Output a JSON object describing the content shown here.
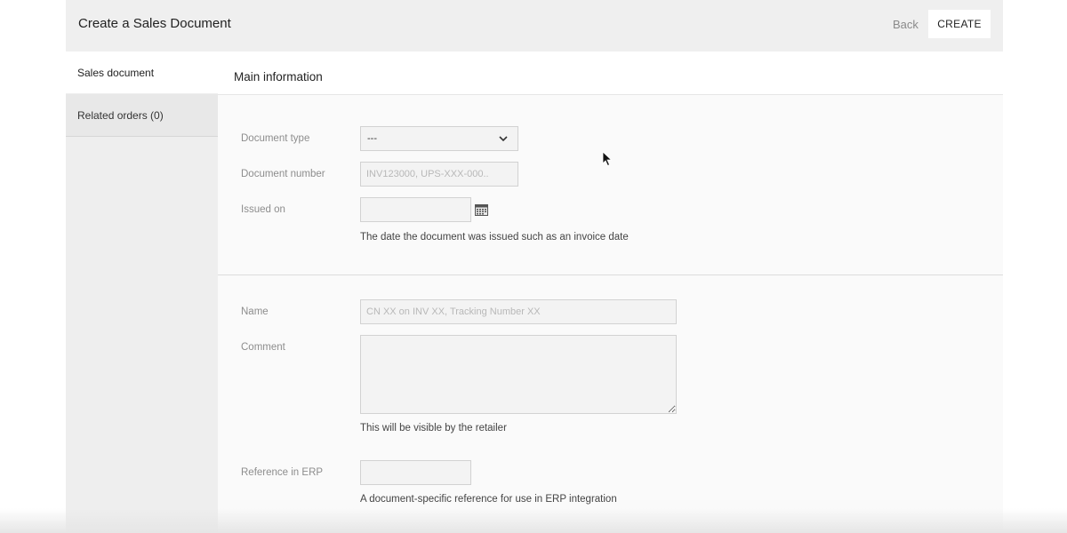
{
  "header": {
    "title": "Create a Sales Document",
    "back_label": "Back",
    "create_label": "CREATE"
  },
  "sidebar": {
    "items": [
      {
        "label": "Sales document",
        "active": true
      },
      {
        "label": "Related orders (0)",
        "active": false
      }
    ]
  },
  "main": {
    "section_title": "Main information",
    "document_type": {
      "label": "Document type",
      "value": "---"
    },
    "document_number": {
      "label": "Document number",
      "value": "",
      "placeholder": "INV123000, UPS-XXX-000.."
    },
    "issued_on": {
      "label": "Issued on",
      "value": "",
      "help": "The date the document was issued such as an invoice date",
      "icon": "calendar-icon"
    },
    "name": {
      "label": "Name",
      "value": "",
      "placeholder": "CN XX on INV XX, Tracking Number XX"
    },
    "comment": {
      "label": "Comment",
      "value": "",
      "help": "This will be visible by the retailer"
    },
    "reference_erp": {
      "label": "Reference in ERP",
      "value": "",
      "help": "A document-specific reference for use in ERP integration"
    }
  },
  "colors": {
    "header_bg": "#efefef",
    "sidebar_bg": "#eeeeee",
    "input_bg": "#f3f3f3",
    "label": "#8d8d8d"
  }
}
